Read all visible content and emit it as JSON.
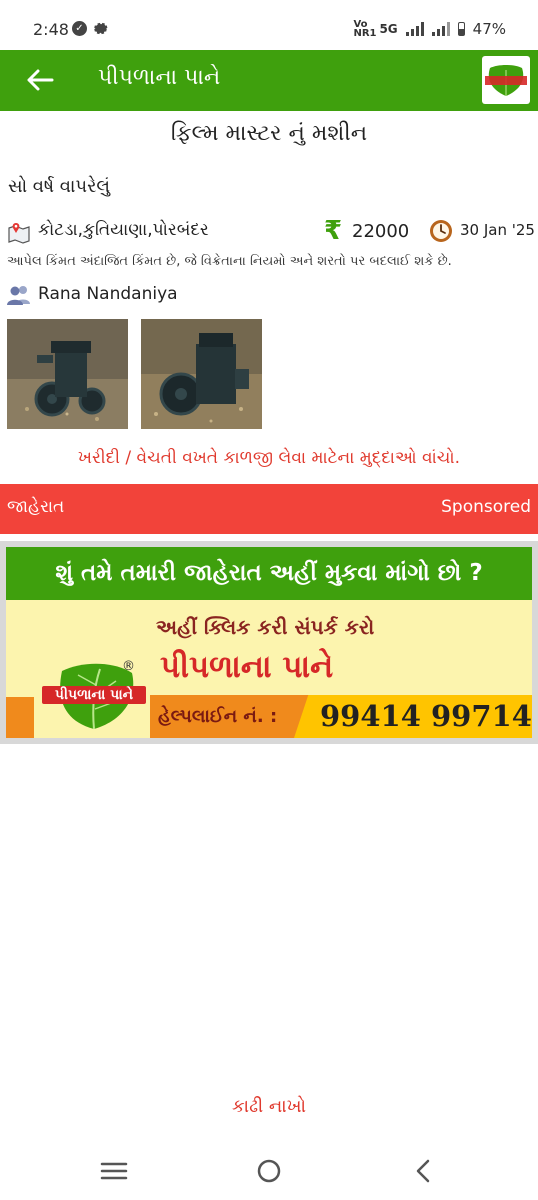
{
  "status_bar": {
    "time": "2:48",
    "network_small": "Vo NR1",
    "network": "5G",
    "battery": "47%"
  },
  "app_bar": {
    "title": "પીપળાના પાને",
    "logo_text": "પીપળાના પાને"
  },
  "listing": {
    "title": "ફિલ્મ માસ્ટર નું મશીન",
    "description": "સો વર્ષ વાપરેલું",
    "location": "કોટડા,કુતિયાણા,પોરબંદર",
    "currency_symbol": "₹",
    "price": "22000",
    "date": "30 Jan '25",
    "note": "આપેલ કિંમત અંદાજિત કિંમત છે, જે વિક્રેતાના નિયમો અને શરતો પર બદલાઈ શકે છે.",
    "seller": "Rana Nandaniya",
    "images": [
      "engine-photo-1",
      "engine-photo-2"
    ]
  },
  "warning_link": "ખરીદી / વેચતી વખતે કાળજી લેવા માટેના મુદ્દાઓ વાંચો.",
  "sponsor_bar": {
    "left": "જાહેરાત",
    "right": "Sponsored"
  },
  "ad": {
    "headline": "શું તમે તમારી જાહેરાત અહીં મુકવા માંગો છો ?",
    "subline": "અહીં ક્લિક કરી સંપર્ક કરો",
    "brand": "પીપળાના પાને",
    "logo_text": "પીપળાના પાને",
    "registered": "®",
    "helpline_label": "હેલ્પલાઈન નં. :",
    "phone": "99414 99714"
  },
  "delete_button": "કાઢી નાખો",
  "colors": {
    "primary_green": "#3fa00d",
    "alert_red": "#f2433a",
    "link_red": "#e03a2e",
    "ad_yellow": "#fcf4ae",
    "ad_orange": "#f08a1c"
  }
}
